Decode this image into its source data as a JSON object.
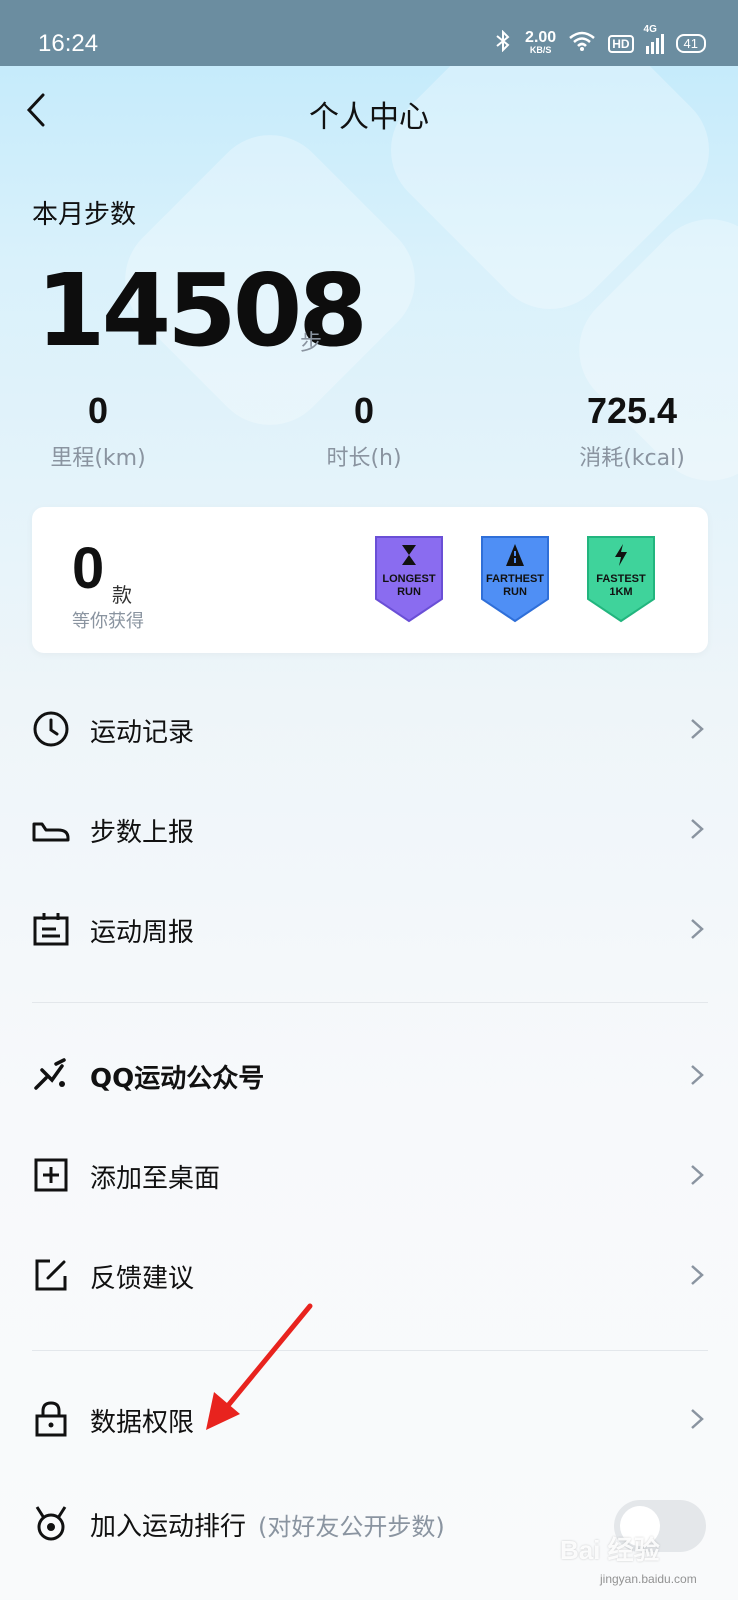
{
  "status_bar": {
    "time": "16:24",
    "net_speed_value": "2.00",
    "net_speed_unit": "KB/S",
    "hd": "HD",
    "network": "4G",
    "battery": "41"
  },
  "header": {
    "title": "个人中心"
  },
  "steps": {
    "label": "本月步数",
    "value": "14508",
    "unit": "步"
  },
  "stats": [
    {
      "value": "0",
      "label": "里程(km)"
    },
    {
      "value": "0",
      "label": "时长(h)"
    },
    {
      "value": "725.4",
      "label": "消耗(kcal)"
    }
  ],
  "badges": {
    "count": "0",
    "unit": "款",
    "subtitle": "等你获得",
    "medals": [
      {
        "line1": "LONGEST",
        "line2": "RUN",
        "color": "#8a6cf0",
        "icon": "hourglass-icon"
      },
      {
        "line1": "FARTHEST",
        "line2": "RUN",
        "color": "#4f8ff5",
        "icon": "road-icon"
      },
      {
        "line1": "FASTEST",
        "line2": "1KM",
        "color": "#3fd39b",
        "icon": "lightning-icon"
      }
    ]
  },
  "menu": {
    "group1": [
      {
        "label": "运动记录",
        "icon": "clock-icon"
      },
      {
        "label": "步数上报",
        "icon": "shoe-icon"
      },
      {
        "label": "运动周报",
        "icon": "report-icon"
      }
    ],
    "group2": [
      {
        "label": "QQ运动公众号",
        "icon": "runner-icon"
      },
      {
        "label": "添加至桌面",
        "icon": "add-square-icon"
      },
      {
        "label": "反馈建议",
        "icon": "edit-icon"
      }
    ],
    "group3": [
      {
        "label": "数据权限",
        "icon": "lock-icon"
      },
      {
        "label": "加入运动排行",
        "hint": "(对好友公开步数)",
        "icon": "medal-icon"
      }
    ]
  },
  "watermark": {
    "text": "Bai 经验",
    "sub": "jingyan.baidu.com"
  },
  "colors": {
    "accent_arrow": "#e8231e",
    "muted": "#8a94a0"
  }
}
